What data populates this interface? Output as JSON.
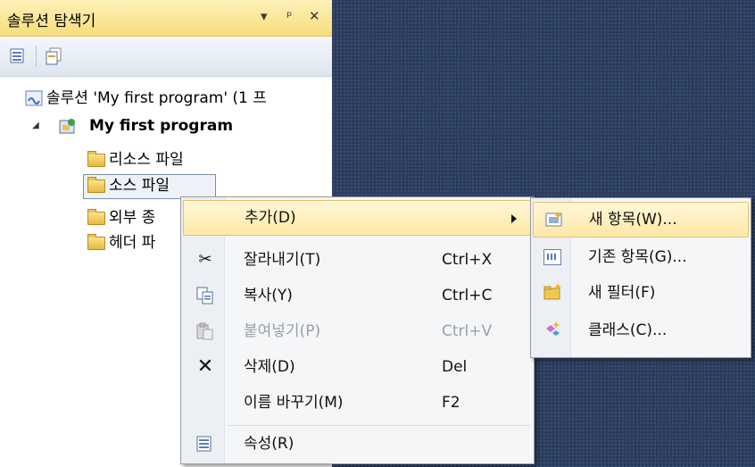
{
  "panel": {
    "title": "솔루션 탐색기",
    "header_buttons": [
      "▾",
      "ᵖ",
      "✕"
    ],
    "toolbar": [
      "properties-icon",
      "show-all-files-icon"
    ]
  },
  "tree": {
    "solution": "솔루션 'My first program' (1 프",
    "project": "My first program",
    "folders": [
      "리소스 파일",
      "소스 파일",
      "외부 종",
      "헤더 파"
    ]
  },
  "context_menu": {
    "items": [
      {
        "label": "추가(D)",
        "shortcut": "",
        "icon": "",
        "submenu": true
      },
      {
        "label": "잘라내기(T)",
        "shortcut": "Ctrl+X",
        "icon": "scissors-icon"
      },
      {
        "label": "복사(Y)",
        "shortcut": "Ctrl+C",
        "icon": "copy-icon"
      },
      {
        "label": "붙여넣기(P)",
        "shortcut": "Ctrl+V",
        "icon": "paste-icon",
        "disabled": true
      },
      {
        "label": "삭제(D)",
        "shortcut": "Del",
        "icon": "delete-icon"
      },
      {
        "label": "이름 바꾸기(M)",
        "shortcut": "F2",
        "icon": ""
      },
      {
        "label": "속성(R)",
        "shortcut": "",
        "icon": "properties-icon"
      }
    ]
  },
  "submenu": {
    "items": [
      {
        "label": "새 항목(W)...",
        "icon": "new-item-icon"
      },
      {
        "label": "기존 항목(G)...",
        "icon": "existing-item-icon"
      },
      {
        "label": "새 필터(F)",
        "icon": "new-filter-icon"
      },
      {
        "label": "클래스(C)...",
        "icon": "class-icon"
      }
    ]
  }
}
